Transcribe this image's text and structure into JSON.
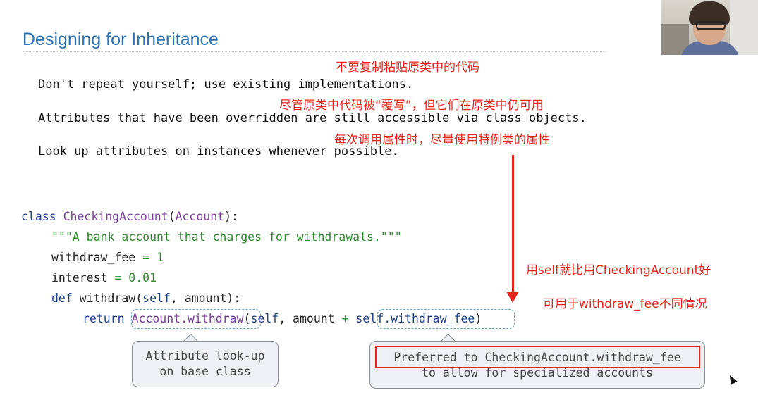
{
  "slide": {
    "title": "Designing for Inheritance",
    "bullets": [
      "Don't repeat yourself; use existing implementations.",
      "Attributes that have been overridden are still accessible via class objects.",
      "Look up attributes on instances whenever possible."
    ]
  },
  "annotations": {
    "note1": "不要复制粘贴原类中的代码",
    "note2": "尽管原类中代码被“覆写”，但它们在原类中仍可用",
    "note3": "每次调用属性时，尽量使用特例类的属性",
    "note4": "用self就比用CheckingAccount好",
    "note5": "可用于withdraw_fee不同情况",
    "color": "#e8241a"
  },
  "code": {
    "l1": {
      "kw": "class",
      "name": "CheckingAccount",
      "open": "(",
      "base": "Account",
      "close": "):"
    },
    "l2": {
      "doc": "\"\"\"A bank account that charges for withdrawals.\"\"\""
    },
    "l3": {
      "name": "withdraw_fee",
      "eq": "=",
      "val": "1"
    },
    "l4": {
      "name": "interest",
      "eq": "=",
      "val": "0.01"
    },
    "l5": {
      "kw": "def",
      "name": "withdraw",
      "open": "(",
      "self": "self",
      "rest": ", amount):"
    },
    "l6": {
      "kw": "return",
      "call": "Account.withdraw",
      "open": "(",
      "self": "self",
      "mid": ", amount ",
      "plus": "+",
      "attr": "self.withdraw_fee",
      "close": ")"
    }
  },
  "callouts": {
    "left": {
      "line1": "Attribute look-up",
      "line2": "on base class"
    },
    "right": {
      "line1": "Preferred to CheckingAccount.withdraw_fee",
      "line2": "to allow for specialized accounts"
    }
  },
  "webcam": {
    "description": "presenter-video"
  },
  "colors": {
    "title": "#2b74b8",
    "keyword": "#1f3f86",
    "classname": "#7a3e9d",
    "string": "#2e8b2e",
    "callout_bg": "#eef0f3"
  }
}
